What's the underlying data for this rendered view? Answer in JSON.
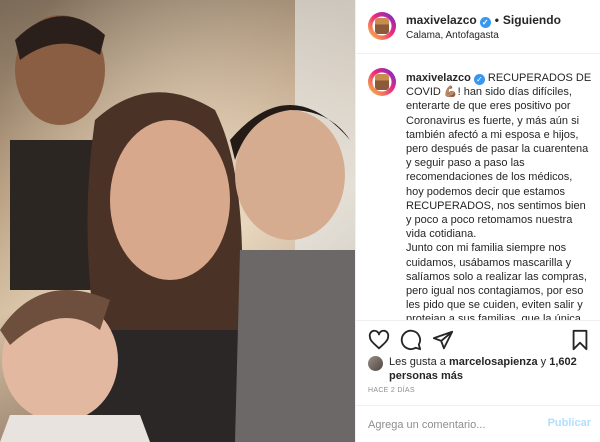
{
  "post": {
    "username": "maxivelazco",
    "follow_state": "Siguiendo",
    "location": "Calama, Antofagasta",
    "photo_alt": "Family selfie",
    "caption_lines_1": [
      "RECUPERADOS DE COVID 💪🏽! han sido días difíciles,",
      "enterarte de que eres positivo por Coronavirus es fuerte, y más aún si también afectó a mi esposa e hijos, pero después de pasar la cuarentena y seguir paso a paso las recomendaciones de los médicos, hoy podemos decir que estamos RECUPERADOS, nos sentimos bien y poco a poco retomamos nuestra vida cotidiana."
    ],
    "caption_para_2": "Junto con mi familia siempre nos cuidamos, usábamos mascarilla y salíamos solo a realizar las compras, pero igual nos contagiamos, por eso les pido que se cuiden, eviten salir y protejan a sus familias, que la única manera de no contagiarse es",
    "likes_prefix": "Les gusta a",
    "likes_user": "marcelosapienza",
    "likes_and": "y",
    "likes_count": "1,602 personas más",
    "date": "HACE 2 DÍAS",
    "comment_placeholder": "Agrega un comentario...",
    "publish_label": "Publicar"
  },
  "icons": {
    "like": "heart-icon",
    "comment": "comment-icon",
    "share": "share-icon",
    "save": "bookmark-icon",
    "verified": "verified-badge-icon"
  },
  "colors": {
    "verified_blue": "#3897f0",
    "publish_disabled": "#b2dffc",
    "muted": "#8e8e8e",
    "text": "#262626"
  }
}
